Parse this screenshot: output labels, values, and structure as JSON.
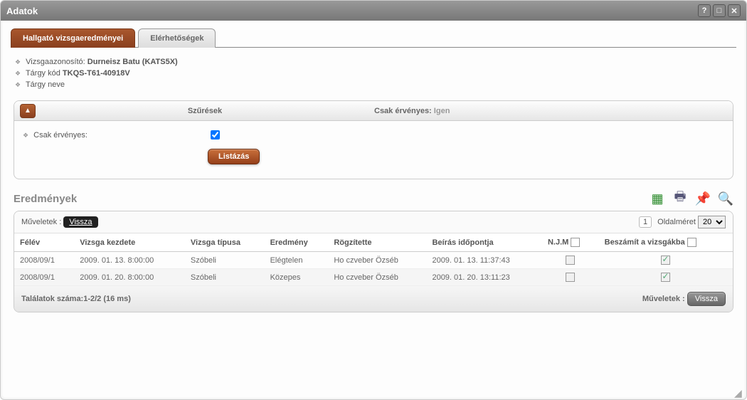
{
  "window": {
    "title": "Adatok"
  },
  "tabs": [
    {
      "label": "Hallgató vizsgaeredményei",
      "active": true
    },
    {
      "label": "Elérhetőségek",
      "active": false
    }
  ],
  "info": {
    "exam_id_label": "Vizsgaazonosító:",
    "exam_id_value": "Durneisz Batu (KATS5X)",
    "subject_code_label": "Tárgy kód",
    "subject_code_value": "TKQS-T61-40918V",
    "subject_name_label": "Tárgy neve"
  },
  "filter": {
    "header_left": "Szűrések",
    "header_right_label": "Csak érvényes:",
    "header_right_value": "Igen",
    "only_valid_label": "Csak érvényes:",
    "only_valid_checked": true,
    "list_button": "Listázás"
  },
  "results": {
    "title": "Eredmények",
    "actions_label": "Műveletek :",
    "back_label": "Vissza",
    "page_number": "1",
    "page_size_label": "Oldalméret",
    "page_size_value": "20",
    "columns": {
      "felev": "Félév",
      "kezdete": "Vizsga kezdete",
      "tipusa": "Vizsga típusa",
      "eredmeny": "Eredmény",
      "rogzitette": "Rögzítette",
      "beiras": "Beírás időpontja",
      "njm": "N.J.M",
      "beszamit": "Beszámít a vizsgákba"
    },
    "rows": [
      {
        "felev": "2008/09/1",
        "kezdete": "2009. 01. 13. 8:00:00",
        "tipusa": "Szóbeli",
        "eredmeny": "Elégtelen",
        "rogzitette": "Ho czveber Özséb",
        "beiras": "2009. 01. 13. 11:37:43",
        "njm": false,
        "beszamit": true
      },
      {
        "felev": "2008/09/1",
        "kezdete": "2009. 01. 20. 8:00:00",
        "tipusa": "Szóbeli",
        "eredmeny": "Közepes",
        "rogzitette": "Ho czveber Özséb",
        "beiras": "2009. 01. 20. 13:11:23",
        "njm": false,
        "beszamit": true
      }
    ],
    "footer_count": "Találatok száma:1-2/2 (16 ms)"
  }
}
